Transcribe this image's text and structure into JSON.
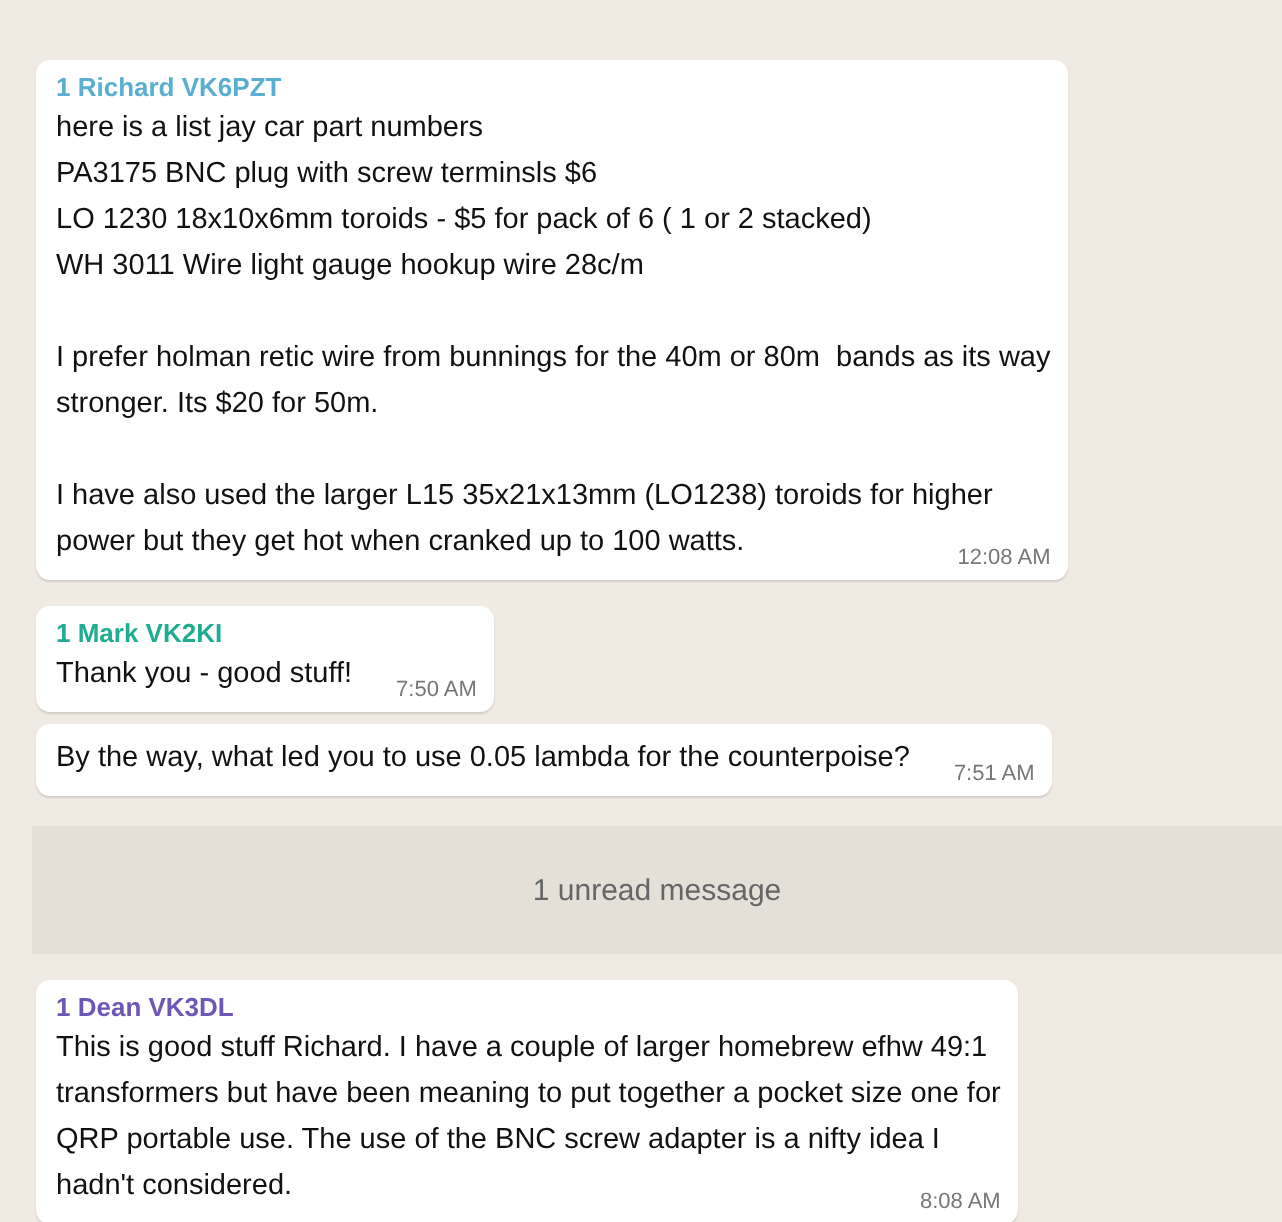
{
  "messages": [
    {
      "sender": "1 Richard VK6PZT",
      "color": "#5aafd1",
      "time": "12:08 AM",
      "paragraphs": [
        [
          "here is a list jay car part numbers",
          "PA3175 BNC plug with screw terminsls $6",
          "LO 1230 18x10x6mm toroids - $5 for pack of 6 ( 1 or 2 stacked)",
          "WH 3011 Wire light gauge hookup wire 28c/m"
        ],
        [
          "I prefer holman retic wire from bunnings for the 40m or 80m  bands as its way",
          "stronger. Its $20 for 50m."
        ],
        [
          "I have also used the larger L15 35x21x13mm (LO1238) toroids for higher",
          "power but they get hot when cranked up to 100 watts."
        ]
      ]
    },
    {
      "sender": "1 Mark VK2KI",
      "color": "#1fad92",
      "time": "7:50 AM",
      "paragraphs": [
        [
          "Thank you - good stuff!"
        ]
      ]
    },
    {
      "time": "7:51 AM",
      "paragraphs": [
        [
          "By the way, what led you to use 0.05 lambda for the counterpoise?"
        ]
      ]
    },
    {
      "kind": "divider",
      "label": "1 unread message"
    },
    {
      "sender": "1 Dean VK3DL",
      "color": "#6e55b8",
      "time": "8:08 AM",
      "paragraphs": [
        [
          "This is good stuff Richard. I have a couple of larger homebrew efhw 49:1",
          "transformers but have been meaning to put together a pocket size one for",
          "QRP portable use. The use of the BNC screw adapter is a nifty idea I",
          "hadn't considered."
        ]
      ]
    }
  ]
}
